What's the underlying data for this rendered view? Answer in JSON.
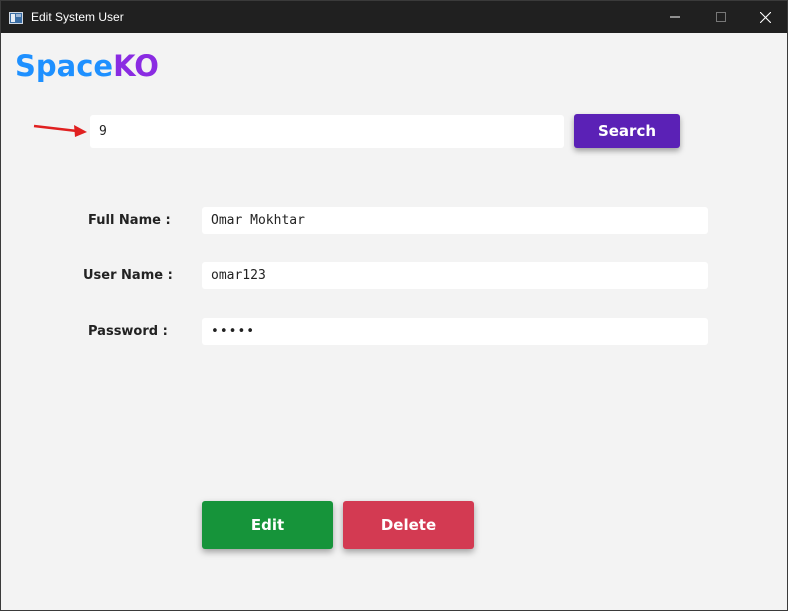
{
  "window": {
    "title": "Edit System User",
    "icons": {
      "app": "app-window-icon",
      "minimize": "minimize-icon",
      "maximize": "maximize-icon",
      "close": "close-icon"
    }
  },
  "brand": {
    "part1": "Space",
    "part2": "KO",
    "colors": {
      "part1": "#1e90ff",
      "part2": "#8a2be2"
    }
  },
  "search": {
    "value": "9",
    "button_label": "Search",
    "button_color": "#5b21b6",
    "annotation": "red-arrow-pointing-to-search-input"
  },
  "form": {
    "full_name_label": "Full Name :",
    "full_name_value": "Omar Mokhtar",
    "user_name_label": "User Name :",
    "user_name_value": "omar123",
    "password_label": "Password :",
    "password_value": "•••••"
  },
  "actions": {
    "edit_label": "Edit",
    "edit_color": "#16943a",
    "delete_label": "Delete",
    "delete_color": "#d33a52"
  }
}
